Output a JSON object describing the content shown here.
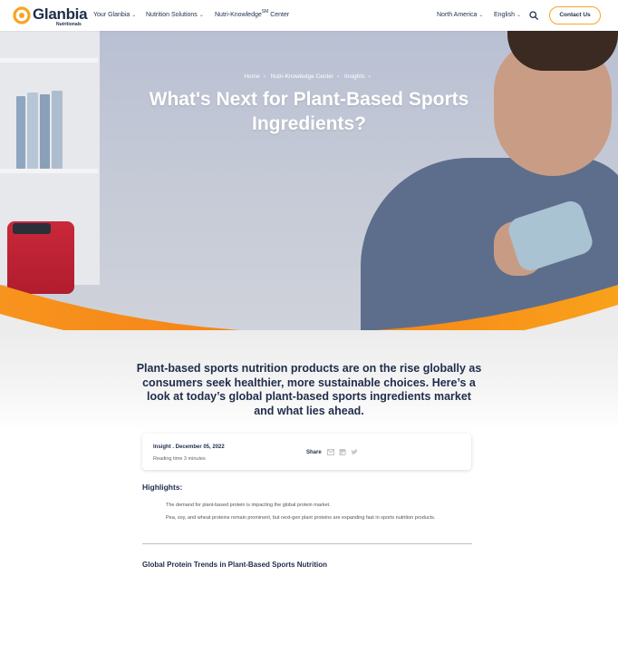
{
  "header": {
    "logo_text": "Glanbia",
    "logo_sub": "Nutritionals",
    "nav": [
      {
        "label": "Your Glanbia"
      },
      {
        "label": "Nutrition Solutions"
      },
      {
        "label": "Nutri-Knowledge",
        "sup": "SM",
        "suffix": "Center"
      }
    ],
    "region": "North America",
    "language": "English",
    "contact_label": "Contact Us",
    "brand_color": "#f5a623"
  },
  "hero": {
    "breadcrumb": [
      "Home",
      "Nutri-Knowledge Center",
      "Insights"
    ],
    "title": "What's Next for Plant-Based Sports Ingredients?"
  },
  "intro": {
    "text": "Plant-based sports nutrition products are on the rise globally as consumers seek healthier, more sustainable choices. Here’s a look at today’s global plant-based sports ingredients market and what lies ahead."
  },
  "meta": {
    "date_line": "Insight . December 05, 2022",
    "reading_time": "Reading time 3 minutes",
    "share_label": "Share",
    "share_icons": [
      "email-icon",
      "linkedin-icon",
      "twitter-icon"
    ]
  },
  "highlights": {
    "title": "Highlights:",
    "items": [
      "The demand for plant-based protein is impacting the global protein market.",
      "Pea, soy, and wheat proteins remain prominent, but next-gen plant proteins are expanding fast in sports nutrition products."
    ]
  },
  "section": {
    "title": "Global Protein Trends in Plant-Based Sports Nutrition"
  }
}
